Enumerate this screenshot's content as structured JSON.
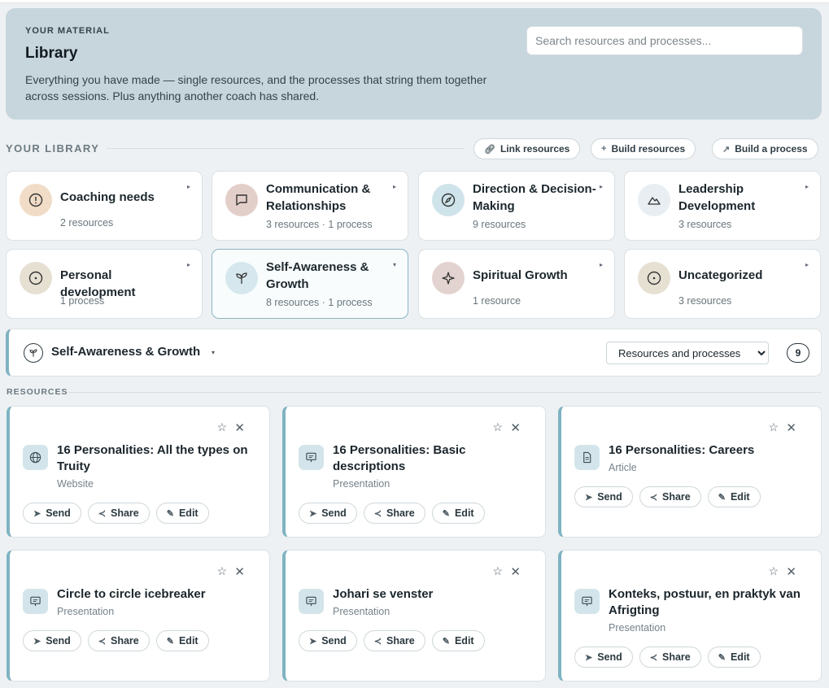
{
  "hero": {
    "eyebrow": "YOUR MATERIAL",
    "title": "Library",
    "description": "Everything you have made — single resources, and the processes that string them together across sessions. Plus anything another coach has shared.",
    "search_placeholder": "Search resources and processes..."
  },
  "library": {
    "label": "YOUR LIBRARY",
    "actions": [
      {
        "label": "Link resources",
        "icon": "link-icon"
      },
      {
        "label": "Build resources",
        "icon": "plus-icon"
      },
      {
        "label": "Build a process",
        "icon": "path-icon"
      }
    ]
  },
  "categories": [
    {
      "name": "Coaching needs",
      "count": "2 resources",
      "icon": "alert-circle-icon",
      "color": "#f0dcc7"
    },
    {
      "name": "Communication & Relationships",
      "count": "3 resources · 1 process",
      "icon": "chat-icon",
      "color": "#e3cfc9"
    },
    {
      "name": "Direction & Decision-Making",
      "count": "9 resources",
      "icon": "compass-icon",
      "color": "#cfe3ea"
    },
    {
      "name": "Leadership Development",
      "count": "3 resources",
      "icon": "mountain-icon",
      "color": "#e8eef1"
    },
    {
      "name": "Personal development",
      "count": "1 process",
      "icon": "circle-dot-icon",
      "color": "#e6e0d3"
    },
    {
      "name": "Self-Awareness & Growth",
      "count": "8 resources · 1 process",
      "icon": "sprout-icon",
      "color": "#d6e8ee"
    },
    {
      "name": "Spiritual Growth",
      "count": "1 resource",
      "icon": "sparkle-icon",
      "color": "#e3d3d0"
    },
    {
      "name": "Uncategorized",
      "count": "3 resources",
      "icon": "circle-dot-icon",
      "color": "#e6e0d3"
    }
  ],
  "filter": {
    "selected": "Self-Awareness & Growth",
    "view_option": "Resources and processes",
    "total": "9"
  },
  "resources_label": "RESOURCES",
  "resources": [
    {
      "title": "16 Personalities: All the types on Truity",
      "type": "Website",
      "icon": "globe-icon"
    },
    {
      "title": "16 Personalities: Basic descriptions",
      "type": "Presentation",
      "icon": "presentation-icon"
    },
    {
      "title": "16 Personalities: Careers",
      "type": "Article",
      "icon": "document-icon"
    },
    {
      "title": "Circle to circle icebreaker",
      "type": "Presentation",
      "icon": "presentation-icon"
    },
    {
      "title": "Johari se venster",
      "type": "Presentation",
      "icon": "presentation-icon"
    },
    {
      "title": "Konteks, postuur, en praktyk van Afrigting",
      "type": "Presentation",
      "icon": "presentation-icon"
    }
  ],
  "resource_actions": {
    "send": "Send",
    "share": "Share",
    "edit": "Edit"
  }
}
